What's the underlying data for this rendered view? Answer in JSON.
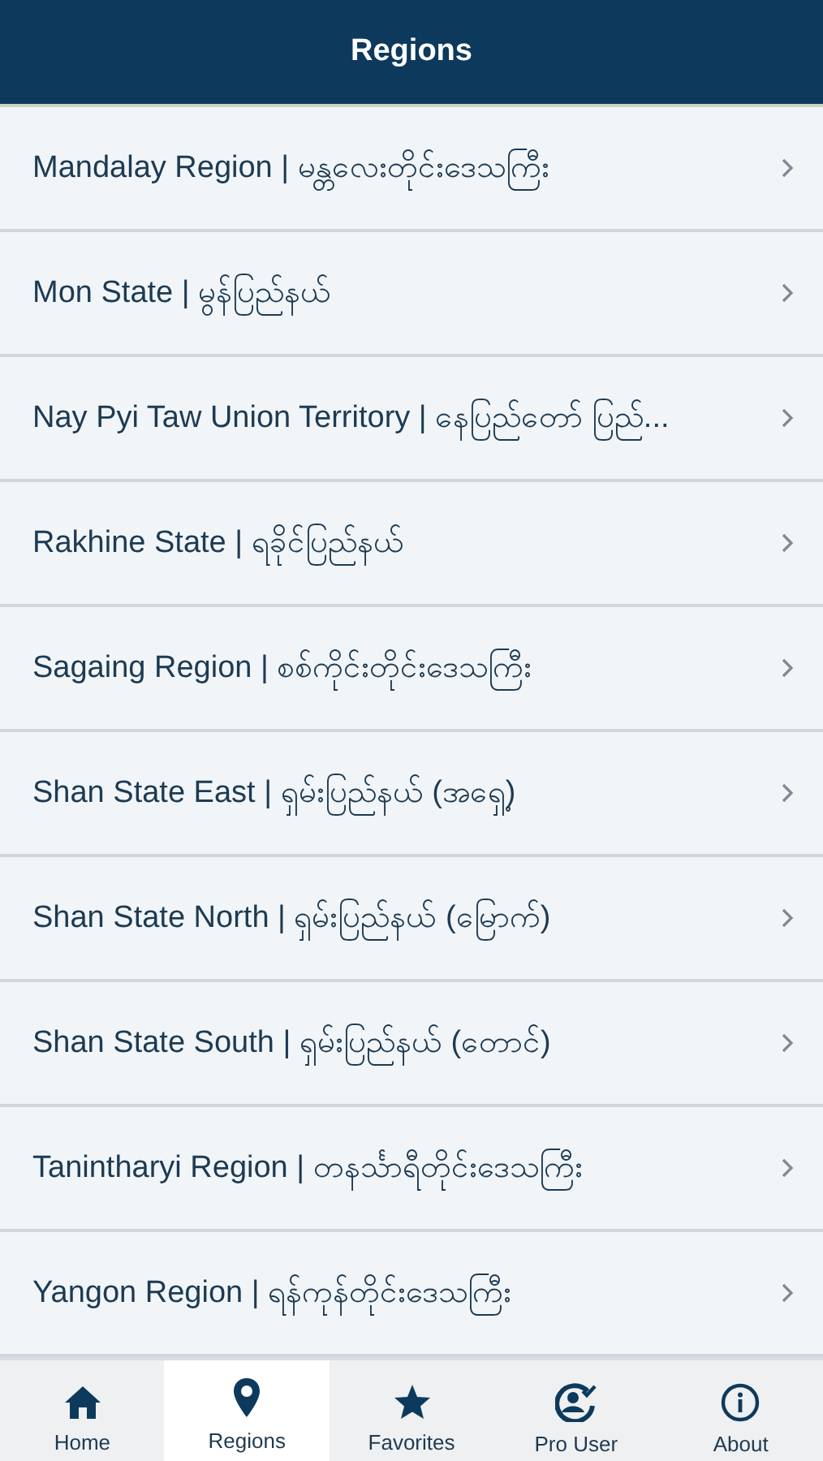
{
  "header": {
    "title": "Regions"
  },
  "regions": [
    {
      "label": "Mandalay Region | မန္တလေးတိုင်းဒေသကြီး"
    },
    {
      "label": "Mon State | မွန်ပြည်နယ်"
    },
    {
      "label": "Nay Pyi Taw Union Territory | နေပြည်တော် ပြည်..."
    },
    {
      "label": "Rakhine State | ရခိုင်ပြည်နယ်"
    },
    {
      "label": "Sagaing Region | စစ်ကိုင်းတိုင်းဒေသကြီး"
    },
    {
      "label": "Shan State East | ရှမ်းပြည်နယ် (အရှေ့)"
    },
    {
      "label": "Shan State North | ရှမ်းပြည်နယ် (မြောက်)"
    },
    {
      "label": "Shan State South | ရှမ်းပြည်နယ် (တောင်)"
    },
    {
      "label": "Tanintharyi Region | တနင်္သာရီတိုင်းဒေသကြီး"
    },
    {
      "label": "Yangon Region | ရန်ကုန်တိုင်းဒေသကြီး"
    }
  ],
  "nav": [
    {
      "kind": "home",
      "label": "Home",
      "selected": false
    },
    {
      "kind": "pin",
      "label": "Regions",
      "selected": true
    },
    {
      "kind": "star",
      "label": "Favorites",
      "selected": false
    },
    {
      "kind": "user",
      "label": "Pro User",
      "selected": false
    },
    {
      "kind": "info",
      "label": "About",
      "selected": false
    }
  ]
}
